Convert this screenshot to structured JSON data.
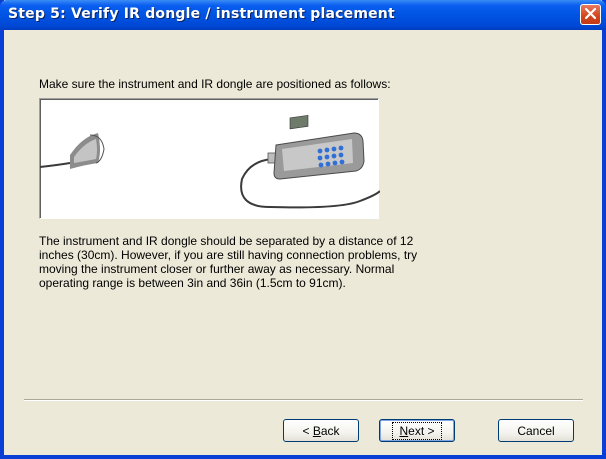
{
  "window": {
    "title": "Step 5: Verify IR dongle / instrument placement"
  },
  "content": {
    "intro": "Make sure the instrument and IR dongle are positioned as follows:",
    "description_lines": [
      "The instrument and IR dongle should be separated by a distance of 12",
      "inches (30cm).  However, if you are still having connection problems, try",
      "moving the instrument closer or further away as necessary.  Normal",
      "operating range is between 3in and 36in (1.5cm to 91cm)."
    ]
  },
  "buttons": {
    "back_mnemonic": "B",
    "back_rest": "ack",
    "back_prefix": "< ",
    "next_mnemonic": "N",
    "next_rest": "ext >",
    "cancel": "Cancel"
  },
  "icons": {
    "close": "close-x-icon",
    "dongle": "ir-dongle-image",
    "instrument": "instrument-image"
  },
  "colors": {
    "titlebar": "#0054e3",
    "close_button": "#d4471f",
    "dialog_bg": "#ece9d8"
  }
}
